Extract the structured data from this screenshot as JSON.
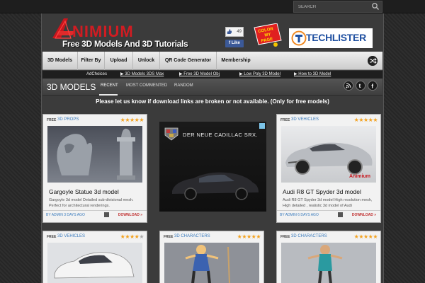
{
  "search": {
    "placeholder": "SEARCH"
  },
  "header": {
    "logo_text": "Animium",
    "tagline": "Free 3D Models And 3D Tutorials",
    "like_count": "49",
    "like_label": "Like",
    "badge_text": [
      "COLOR",
      "MY",
      "PAGE"
    ],
    "partner_name": "TECHLISTER"
  },
  "nav": {
    "items": [
      "3D Models",
      "Filter By",
      "Upload",
      "Unlock",
      "QR Code Generator",
      "Membership"
    ]
  },
  "adrow": {
    "adchoices": "AdChoices",
    "links": [
      "▶ 3D Models 3DS Max",
      "▶ Free 3D Model Obj",
      "▶ Low Poly 3D Model",
      "▶ How to 3D Model"
    ]
  },
  "section": {
    "title": "3D MODELS",
    "tabs": [
      "RECENT",
      "MOST COMMENTED",
      "RANDOM"
    ]
  },
  "notice": "Please let us know if download links are broken or not available. (Only for free models)",
  "ad": {
    "headline": "DER NEUE CADILLAC SRX."
  },
  "colors": {
    "accent": "#3a7bbd",
    "download": "#c03030",
    "star": "#f3a11d"
  },
  "cards": [
    {
      "free": "FREE",
      "category": "3D PROPS",
      "stars": 5,
      "title": "Gargoyle Statue 3d model",
      "desc": "Gargoyle 3d model Detailed sub-divisional mesh. Perfect for architectural renderings.",
      "byline": "BY ADMIN 3 DAYS AGO",
      "comments": "0",
      "download": "DOWNLOAD »"
    },
    {
      "free": "FREE",
      "category": "3D VEHICLES",
      "stars": 5,
      "title": "Audi R8 GT Spyder 3d model",
      "desc": "Audi R8 GT Spyder 3d model High resolution mesh, High detailed , realistic 3d model of Audi",
      "byline": "BY ADMIN 6 DAYS AGO",
      "comments": "0",
      "download": "DOWNLOAD »"
    },
    {
      "free": "FREE",
      "category": "3D VEHICLES",
      "stars": 4
    },
    {
      "free": "FREE",
      "category": "3D CHARACTERS",
      "stars": 5
    },
    {
      "free": "FREE",
      "category": "3D CHARACTERS",
      "stars": 5
    }
  ]
}
